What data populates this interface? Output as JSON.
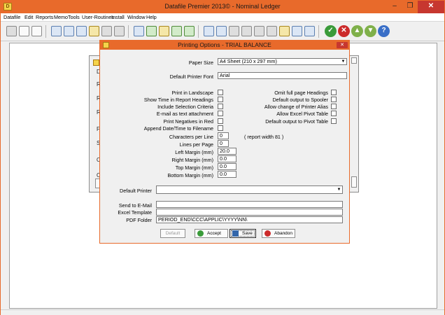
{
  "window": {
    "title": "Datafile  Premier 2013© - Nominal Ledger",
    "app_icon": "D"
  },
  "menu": [
    "Datafile",
    "Edit",
    "Reports",
    "Memo",
    "Tools",
    "User-Routines",
    "Install",
    "Window",
    "Help"
  ],
  "background_panel": {
    "labels": [
      "D",
      "R",
      "R",
      "R",
      "Fi",
      "S",
      "O",
      "O",
      "A"
    ]
  },
  "dialog": {
    "title": "Printing Options - TRIAL BALANCE",
    "paper_size_label": "Paper Size",
    "paper_size_value": "A4 Sheet (210 x 297 mm)",
    "default_printer_font_label": "Default Printer Font",
    "default_printer_font_value": "Arial",
    "left_checks": [
      "Print in Landscape",
      "Show Time in Report Headings",
      "Include Selection Criteria",
      "E-mail as text attachment",
      "Print Negatives in Red",
      "Append Date/Time to Filename"
    ],
    "right_checks": [
      "Omit full page Headings",
      "Default output to Spooler",
      "Allow change of Printer Alias",
      "Allow Excel Pivot Table",
      "Default output to Pivot Table"
    ],
    "characters_per_line_label": "Characters per Line",
    "characters_per_line_value": "0",
    "report_width_note": "( report width 81 )",
    "lines_per_page_label": "Lines per Page",
    "lines_per_page_value": "0",
    "left_margin_label": "Left Margin (mm)",
    "left_margin_value": "20.0",
    "right_margin_label": "Right Margin (mm)",
    "right_margin_value": "0.0",
    "top_margin_label": "Top Margin (mm)",
    "top_margin_value": "0.0",
    "bottom_margin_label": "Bottom Margin (mm)",
    "bottom_margin_value": "0.0",
    "default_printer_label": "Default Printer",
    "default_printer_value": "",
    "send_to_email_label": "Send to E-Mail",
    "send_to_email_value": "",
    "excel_template_label": "Excel Template",
    "excel_template_value": "",
    "pdf_folder_label": "PDF Folder",
    "pdf_folder_value": "PERIOD_END\\CCC\\APPLIC\\YYYY\\NN\\",
    "buttons": {
      "default": "Default",
      "accept": "Accept",
      "save": "Save",
      "abandon": "Abandon"
    }
  },
  "colors": {
    "titlebar": "#e86a2b",
    "close": "#c7372f",
    "accept": "#3a9b3a",
    "abandon": "#cc2b2b",
    "save": "#3366aa"
  }
}
